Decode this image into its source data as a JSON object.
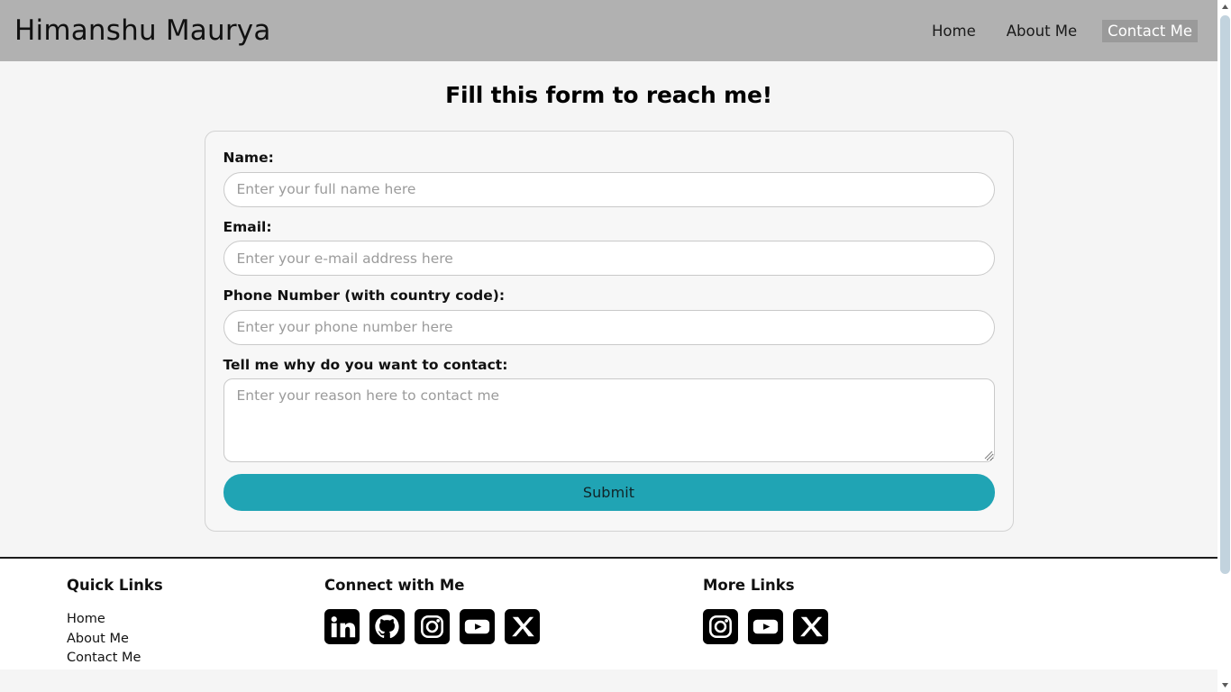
{
  "header": {
    "brand": "Himanshu Maurya",
    "nav": [
      {
        "label": "Home",
        "active": false
      },
      {
        "label": "About Me",
        "active": false
      },
      {
        "label": "Contact Me",
        "active": true
      }
    ]
  },
  "main": {
    "title": "Fill this form to reach me!",
    "form": {
      "fields": [
        {
          "label": "Name:",
          "placeholder": "Enter your full name here",
          "value": "",
          "type": "text"
        },
        {
          "label": "Email:",
          "placeholder": "Enter your e-mail address here",
          "value": "",
          "type": "email"
        },
        {
          "label": "Phone Number (with country code):",
          "placeholder": "Enter your phone number here",
          "value": "",
          "type": "tel"
        },
        {
          "label": "Tell me why do you want to contact:",
          "placeholder": "Enter your reason here to contact me",
          "value": "",
          "type": "textarea"
        }
      ],
      "submit_label": "Submit"
    }
  },
  "footer": {
    "quick_links": {
      "heading": "Quick Links",
      "items": [
        {
          "label": "Home"
        },
        {
          "label": "About Me"
        },
        {
          "label": "Contact Me"
        }
      ]
    },
    "connect": {
      "heading": "Connect with Me",
      "icons": [
        {
          "name": "linkedin-icon"
        },
        {
          "name": "github-icon"
        },
        {
          "name": "instagram-icon"
        },
        {
          "name": "youtube-icon"
        },
        {
          "name": "x-twitter-icon"
        }
      ]
    },
    "more_links": {
      "heading": "More Links",
      "icons": [
        {
          "name": "instagram-icon"
        },
        {
          "name": "youtube-icon"
        },
        {
          "name": "x-twitter-icon"
        }
      ]
    }
  },
  "colors": {
    "header_bg": "#b1b1b1",
    "nav_active_bg": "#9a9a9a",
    "page_bg": "#f5f5f5",
    "submit_bg": "#20a4b4",
    "icon_bg": "#000000",
    "scrollbar_thumb": "#c2d3de"
  },
  "scrollbar": {
    "up_arrow": "▲",
    "down_arrow": "▼"
  }
}
